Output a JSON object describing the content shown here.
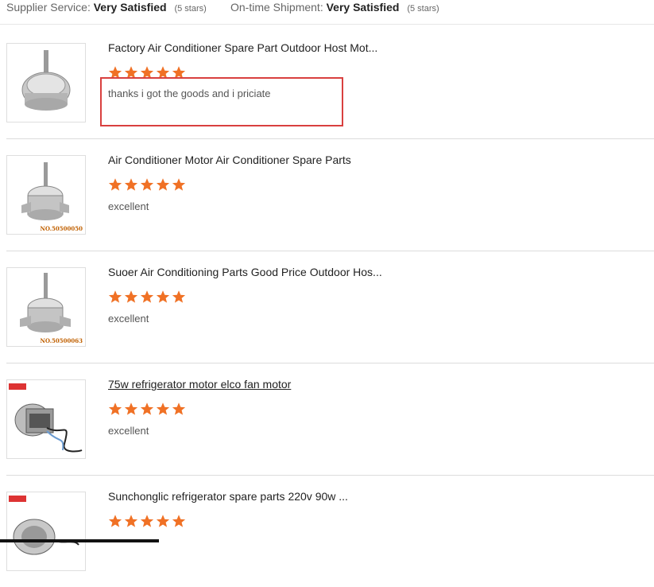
{
  "header": {
    "supplier_service_label": "Supplier Service:",
    "supplier_service_value": "Very Satisfied",
    "supplier_service_stars": "(5 stars)",
    "shipment_label": "On-time Shipment:",
    "shipment_value": "Very Satisfied",
    "shipment_stars": "(5 stars)"
  },
  "colors": {
    "star": "#f07125",
    "highlight_border": "#d9403f"
  },
  "reviews": [
    {
      "title": "Factory Air Conditioner Spare Part Outdoor Host Mot...",
      "rating": 5,
      "comment": "thanks i got the goods and i priciate",
      "image_icon": "ac-fan-motor-icon",
      "image_code": ""
    },
    {
      "title": "Air Conditioner Motor Air Conditioner Spare Parts",
      "rating": 5,
      "comment": "excellent",
      "image_icon": "ac-fan-motor-icon",
      "image_code": "NO.50500050"
    },
    {
      "title": "Suoer Air Conditioning Parts Good Price Outdoor Hos...",
      "rating": 5,
      "comment": "excellent",
      "image_icon": "ac-fan-motor-icon",
      "image_code": "NO.50500063"
    },
    {
      "title": "75w refrigerator motor elco fan motor",
      "rating": 5,
      "comment": "excellent",
      "image_icon": "refrigerator-fan-motor-icon",
      "image_code": ""
    },
    {
      "title": "Sunchonglic refrigerator spare parts 220v 90w ...",
      "rating": 5,
      "comment": "",
      "image_icon": "refrigerator-fan-motor-icon",
      "image_code": ""
    }
  ]
}
